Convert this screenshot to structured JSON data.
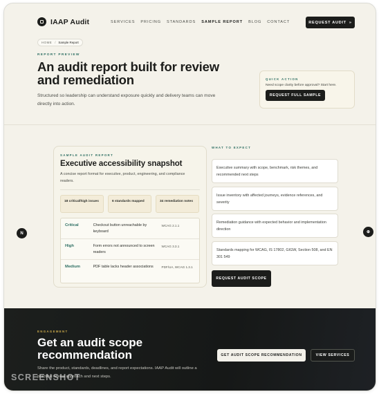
{
  "nav": {
    "logo_text": "IAAP Audit",
    "links": [
      "SERVICES",
      "PRICING",
      "STANDARDS",
      "SAMPLE REPORT",
      "BLOG",
      "CONTACT"
    ],
    "cta": "REQUEST AUDIT",
    "cta_arrow": "»"
  },
  "breadcrumb": {
    "home": "HOME",
    "sep": "/",
    "current": "Sample Report"
  },
  "hero": {
    "eyebrow": "REPORT PREVIEW",
    "title": "An audit report built for review and remediation",
    "subtitle": "Structured so leadership can understand exposure quickly and delivery teams can move directly into action."
  },
  "quick_action": {
    "eyebrow": "QUICK ACTION",
    "text": "Need scope clarity before approval? Start here.",
    "button": "REQUEST FULL SAMPLE"
  },
  "report": {
    "eyebrow": "SAMPLE AUDIT REPORT",
    "title": "Executive accessibility snapshot",
    "description": "A concise report format for executive, product, engineering, and compliance readers.",
    "stats": [
      "18 critical/high issues",
      "6 standards mapped",
      "34 remediation notes"
    ],
    "issues": [
      {
        "severity": "Critical",
        "description": "Checkout button unreachable by keyboard",
        "standard": "WCAG 2.1.1"
      },
      {
        "severity": "High",
        "description": "Form errors not announced to screen readers",
        "standard": "WCAG 3.3.1"
      },
      {
        "severity": "Medium",
        "description": "PDF table lacks header associations",
        "standard": "PDF/UA, WCAG 1.3.1"
      }
    ]
  },
  "expect": {
    "eyebrow": "WHAT TO EXPECT",
    "items": [
      "Executive summary with scope, benchmark, risk themes, and recommended next steps",
      "Issue inventory with affected journeys, evidence references, and severity",
      "Remediation guidance with expected behavior and implementation direction",
      "Standards mapping for WCAG, IS 17802, GIGW, Section 508, and EN 301 549"
    ],
    "button": "REQUEST AUDIT SCOPE"
  },
  "side": {
    "left_label": "N",
    "right_label": "⊕"
  },
  "engagement": {
    "eyebrow": "ENGAGEMENT",
    "title": "Get an audit scope recommendation",
    "subtitle": "Share the product, standards, deadlines, and report expectations. IAAP Audit will outline a practical review approach and next steps.",
    "primary": "GET AUDIT SCOPE RECOMMENDATION",
    "secondary": "VIEW SERVICES"
  },
  "watermark": "SCREENSHOT",
  "colors": {
    "accent": "#2e6f63",
    "dark": "#1c1d1b",
    "background": "#f4f2ea",
    "gold": "#c9a94a"
  }
}
